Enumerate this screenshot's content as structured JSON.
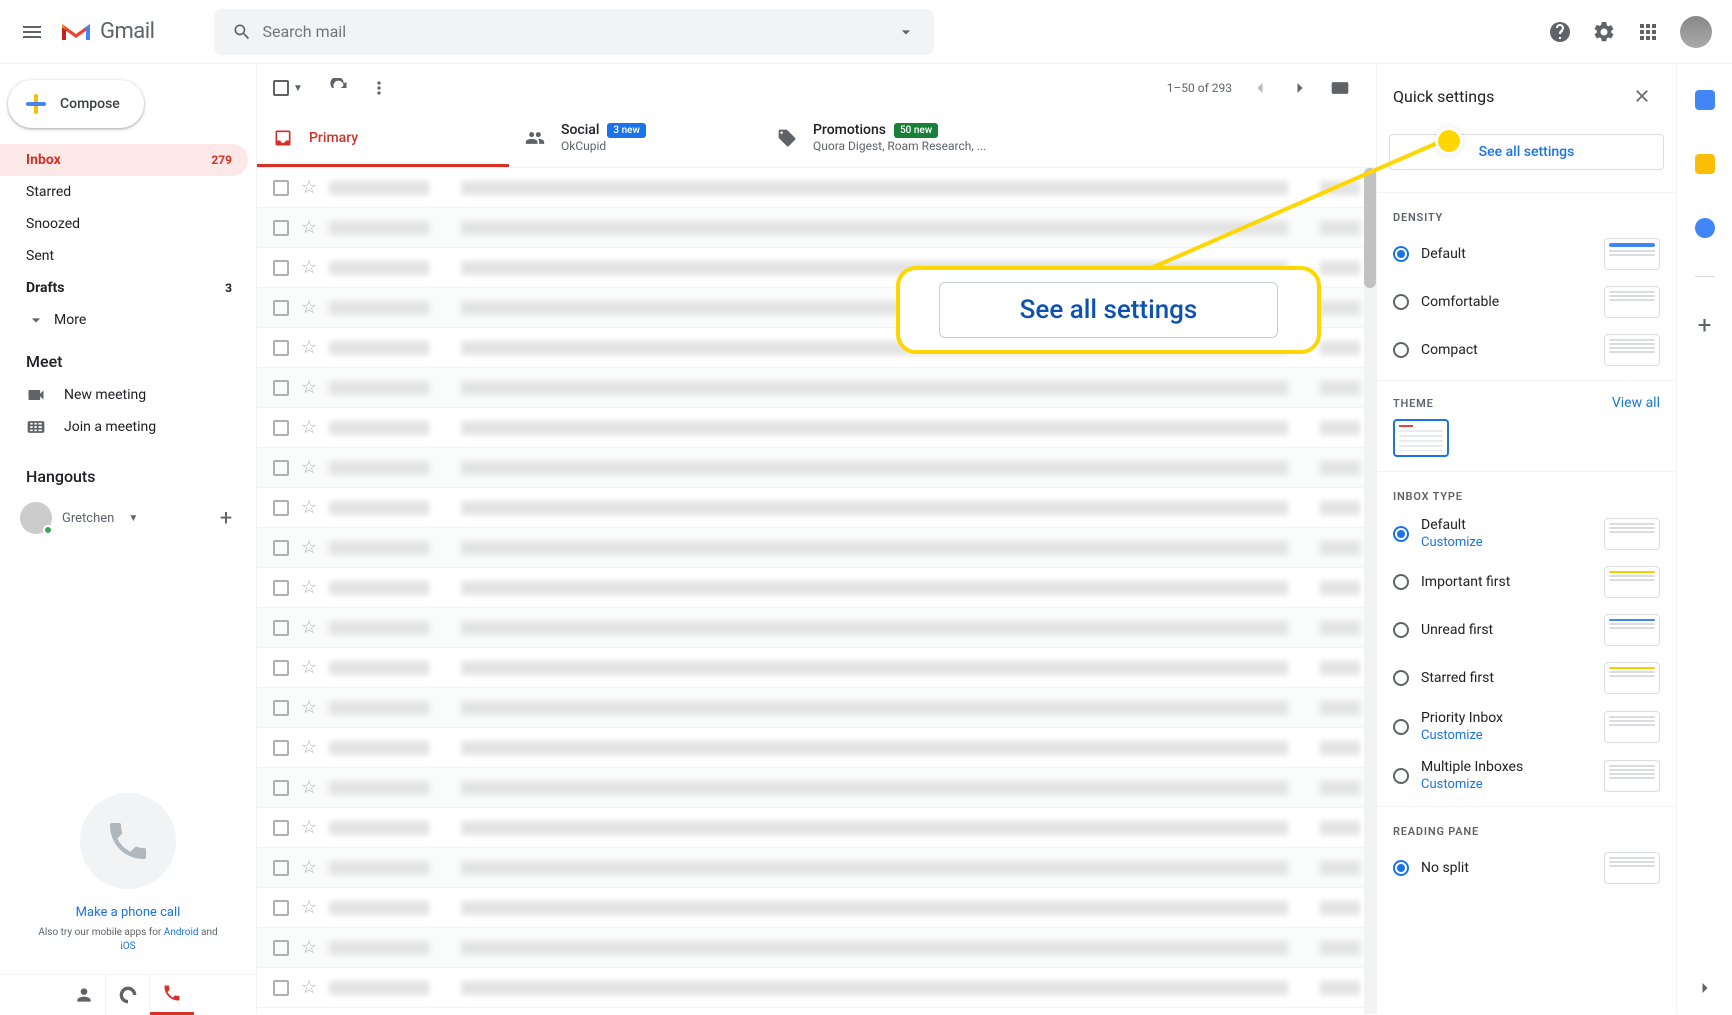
{
  "header": {
    "logo_text": "Gmail",
    "search_placeholder": "Search mail"
  },
  "compose_label": "Compose",
  "sidebar": {
    "items": [
      {
        "label": "Inbox",
        "count": "279",
        "active": true,
        "bold": true
      },
      {
        "label": "Starred"
      },
      {
        "label": "Snoozed"
      },
      {
        "label": "Sent"
      },
      {
        "label": "Drafts",
        "count": "3",
        "bold": true
      }
    ],
    "more_label": "More"
  },
  "meet": {
    "header": "Meet",
    "items": [
      {
        "label": "New meeting"
      },
      {
        "label": "Join a meeting"
      }
    ]
  },
  "hangouts": {
    "header": "Hangouts",
    "user_name": "Gretchen"
  },
  "sidebar_promo": {
    "phone_link": "Make a phone call",
    "sub_prefix": "Also try our mobile apps for ",
    "android": "Android",
    "and": " and ",
    "ios": "iOS"
  },
  "toolbar": {
    "pager": "1–50 of 293"
  },
  "tabs": [
    {
      "title": "Primary",
      "active": true
    },
    {
      "title": "Social",
      "badge": "3 new",
      "badge_class": "",
      "sub": "OkCupid"
    },
    {
      "title": "Promotions",
      "badge": "50 new",
      "badge_class": "green",
      "sub": "Quora Digest, Roam Research, ..."
    }
  ],
  "quick_settings": {
    "title": "Quick settings",
    "see_all": "See all settings",
    "density_header": "DENSITY",
    "density_options": [
      "Default",
      "Comfortable",
      "Compact"
    ],
    "theme_header": "THEME",
    "view_all": "View all",
    "inbox_type_header": "INBOX TYPE",
    "inbox_options": [
      {
        "label": "Default",
        "customize": "Customize",
        "checked": true
      },
      {
        "label": "Important first"
      },
      {
        "label": "Unread first"
      },
      {
        "label": "Starred first"
      },
      {
        "label": "Priority Inbox",
        "customize": "Customize"
      },
      {
        "label": "Multiple Inboxes",
        "customize": "Customize"
      }
    ],
    "reading_pane_header": "READING PANE",
    "reading_pane_options": [
      {
        "label": "No split",
        "checked": true
      }
    ]
  },
  "callout_text": "See all settings"
}
